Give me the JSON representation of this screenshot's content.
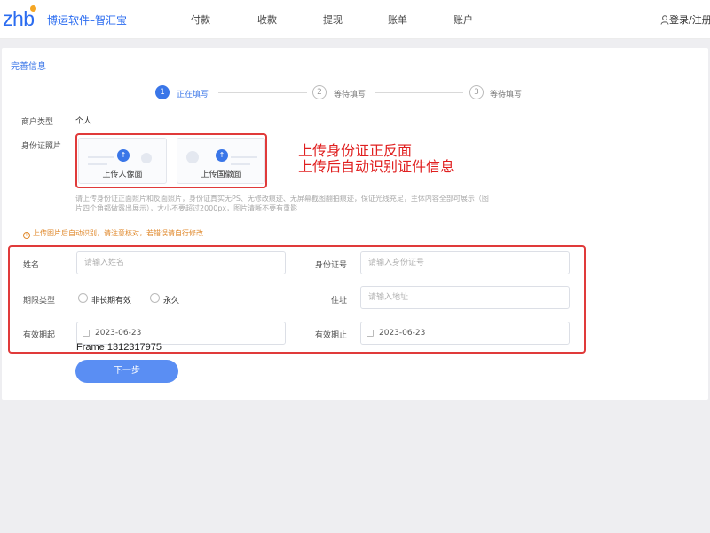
{
  "header": {
    "logo": "zhb",
    "brand": "博运软件–智汇宝",
    "nav": [
      "付款",
      "收款",
      "提现",
      "账单",
      "账户"
    ],
    "login": "登录/注册"
  },
  "page": {
    "title": "完善信息",
    "steps": [
      {
        "num": "1",
        "label": "正在填写"
      },
      {
        "num": "2",
        "label": "等待填写"
      },
      {
        "num": "3",
        "label": "等待填写"
      }
    ],
    "merchant_type_label": "商户类型",
    "merchant_type_value": "个人",
    "id_photo_label": "身份证照片",
    "upload_front": "上传人像面",
    "upload_back": "上传国徽面",
    "annotation_line1": "上传身份证正反面",
    "annotation_line2": "上传后自动识别证件信息",
    "hint": "请上传身份证正面照片和反面照片，身份证真实无PS、无修改痕迹、无屏幕截图翻拍痕迹，保证光线充足，主体内容全部可展示（图片四个角都做露出展示），大小不要超过2000px，图片清晰不要有重影",
    "warning": "上传图片后自动识别，请注意核对，若错误请自行修改"
  },
  "form": {
    "name_label": "姓名",
    "name_placeholder": "请输入姓名",
    "id_label": "身份证号",
    "id_placeholder": "请输入身份证号",
    "period_label": "期限类型",
    "period_options": [
      "非长期有效",
      "永久"
    ],
    "address_label": "住址",
    "address_placeholder": "请输入地址",
    "valid_from_label": "有效期起",
    "valid_from_value": "2023-06-23",
    "valid_to_label": "有效期止",
    "valid_to_value": "2023-06-23"
  },
  "frame_label": "Frame 1312317975",
  "next_button": "下一步",
  "colors": {
    "accent": "#3a76e8",
    "annotation": "#e02020",
    "warning": "#e08a2e"
  }
}
